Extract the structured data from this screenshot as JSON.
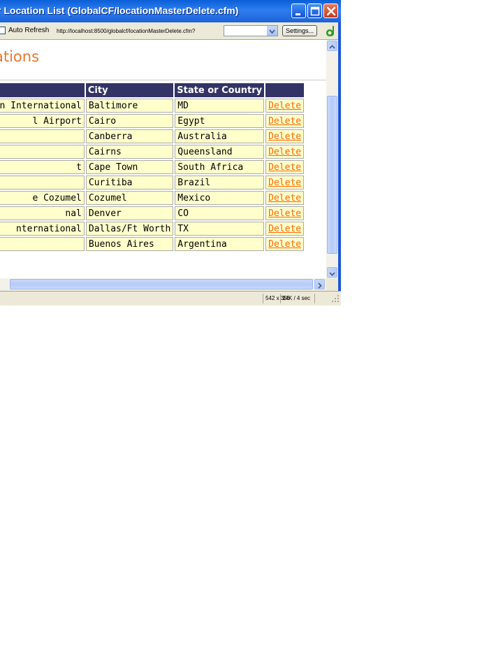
{
  "window": {
    "title": "r Location List (GlobalCF/locationMasterDelete.cfm)"
  },
  "toolbar": {
    "auto_refresh_label": "Auto Refresh",
    "url": "http://localhost:8500/globalcf/locationMasterDelete.cfm?",
    "settings_label": "Settings..."
  },
  "page": {
    "title": "ations"
  },
  "table": {
    "headers": [
      "",
      "City",
      "State or Country",
      ""
    ],
    "rows": [
      {
        "name": "gton International",
        "city": "Baltimore",
        "state": "MD",
        "action": "Delete"
      },
      {
        "name": "l Airport",
        "city": "Cairo",
        "state": "Egypt",
        "action": "Delete"
      },
      {
        "name": "",
        "city": "Canberra",
        "state": "Australia",
        "action": "Delete"
      },
      {
        "name": "",
        "city": "Cairns",
        "state": "Queensland",
        "action": "Delete"
      },
      {
        "name": "t",
        "city": "Cape Town",
        "state": "South Africa",
        "action": "Delete"
      },
      {
        "name": "",
        "city": "Curitiba",
        "state": "Brazil",
        "action": "Delete"
      },
      {
        "name": "e Cozumel",
        "city": "Cozumel",
        "state": "Mexico",
        "action": "Delete"
      },
      {
        "name": "nal",
        "city": "Denver",
        "state": "CO",
        "action": "Delete"
      },
      {
        "name": "nternational",
        "city": "Dallas/Ft Worth",
        "state": "TX",
        "action": "Delete"
      },
      {
        "name": "",
        "city": "Buenos Aires",
        "state": "Argentina",
        "action": "Delete"
      }
    ]
  },
  "statusbar": {
    "dimensions": "542 x 356",
    "size_time": "14K / 4 sec"
  },
  "colors": {
    "title_accent": "#e8782d",
    "header_bg": "#333366",
    "cell_bg": "#ffffcc",
    "link": "#ff6600"
  },
  "icons": [
    "minimize-icon",
    "maximize-icon",
    "close-icon",
    "dropdown-arrow-icon",
    "dreamweaver-icon",
    "scroll-up-icon",
    "scroll-down-icon",
    "scroll-right-icon",
    "resize-grip-icon"
  ]
}
